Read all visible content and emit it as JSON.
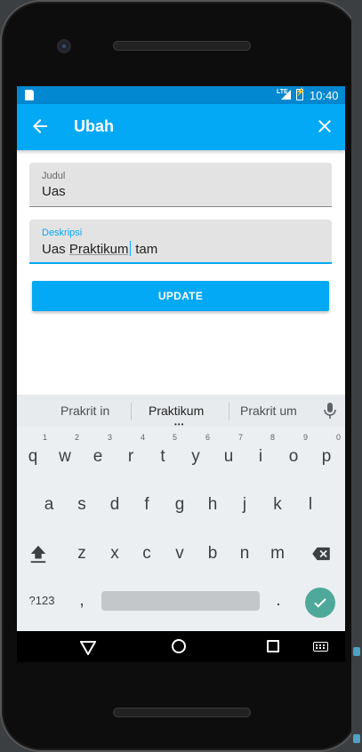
{
  "status_bar": {
    "lte": "LTE",
    "time": "10:40"
  },
  "app_bar": {
    "title": "Ubah",
    "back_icon": "arrow-back-icon",
    "close_icon": "close-icon"
  },
  "form": {
    "judul": {
      "label": "Judul",
      "value": "Uas"
    },
    "deskripsi": {
      "label": "Deskripsi",
      "value_before": "Uas ",
      "value_underlined": "Praktikum",
      "value_after": " tam"
    },
    "update_label": "UPDATE"
  },
  "keyboard": {
    "suggestions": [
      "Prakrit in",
      "Praktikum",
      "Prakrit um"
    ],
    "more_dots": "•••",
    "row1": [
      "q",
      "w",
      "e",
      "r",
      "t",
      "y",
      "u",
      "i",
      "o",
      "p"
    ],
    "row1_hints": [
      "1",
      "2",
      "3",
      "4",
      "5",
      "6",
      "7",
      "8",
      "9",
      "0"
    ],
    "row2": [
      "a",
      "s",
      "d",
      "f",
      "g",
      "h",
      "j",
      "k",
      "l"
    ],
    "row3": [
      "z",
      "x",
      "c",
      "v",
      "b",
      "n",
      "m"
    ],
    "symbols_label": "?123",
    "comma": ",",
    "period": "."
  },
  "colors": {
    "primary": "#03a9f4",
    "status_bar": "#0288d1",
    "enter_key": "#4fa99a"
  }
}
